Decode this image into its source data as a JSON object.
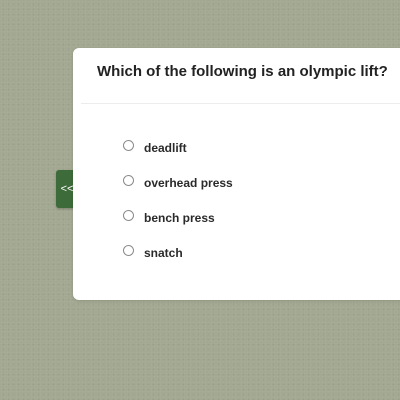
{
  "nav": {
    "back_label": "<<"
  },
  "quiz": {
    "question": "Which of the following is an olympic lift?",
    "options": [
      {
        "label": "deadlift"
      },
      {
        "label": "overhead press"
      },
      {
        "label": "bench press"
      },
      {
        "label": "snatch"
      }
    ]
  },
  "colors": {
    "background": "#a2a891",
    "accent": "#3d6b39",
    "card": "#ffffff"
  }
}
